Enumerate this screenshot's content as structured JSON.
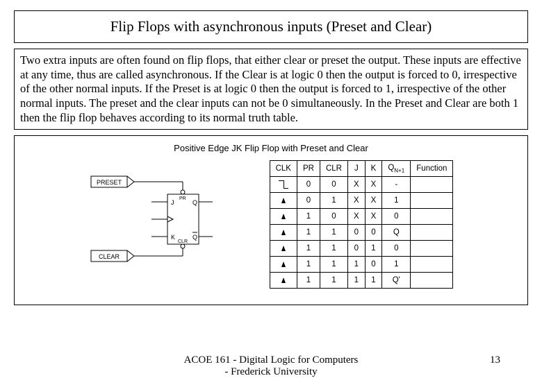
{
  "title": "Flip Flops with asynchronous inputs (Preset and Clear)",
  "body_text": "Two extra inputs are often found on flip flops, that either clear or preset the output. These inputs are effective at any time, thus are called asynchronous. If the Clear is at logic 0 then the output is forced to 0, irrespective of the other normal inputs. If the Preset is at logic 0 then the output is forced to 1, irrespective of the other normal inputs. The preset and the clear inputs can not be 0 simultaneously. In the Preset and Clear are both 1 then the flip flop behaves according to its normal truth table.",
  "figure_title": "Positive Edge JK Flip Flop with Preset and Clear",
  "circuit": {
    "preset_label": "PRESET",
    "clear_label": "CLEAR",
    "j_label": "J",
    "k_label": "K",
    "pr_label": "PR",
    "clr_label": "CLR",
    "q_label": "Q",
    "qbar_label": "Q"
  },
  "table": {
    "headers": [
      "CLK",
      "PR",
      "CLR",
      "J",
      "K",
      "QN+1",
      "Function"
    ],
    "rows": [
      {
        "clk": "fall",
        "pr": "0",
        "clr": "0",
        "j": "X",
        "k": "X",
        "q": "-",
        "func": ""
      },
      {
        "clk": "rise",
        "pr": "0",
        "clr": "1",
        "j": "X",
        "k": "X",
        "q": "1",
        "func": ""
      },
      {
        "clk": "rise",
        "pr": "1",
        "clr": "0",
        "j": "X",
        "k": "X",
        "q": "0",
        "func": ""
      },
      {
        "clk": "rise",
        "pr": "1",
        "clr": "1",
        "j": "0",
        "k": "0",
        "q": "Q",
        "func": ""
      },
      {
        "clk": "rise",
        "pr": "1",
        "clr": "1",
        "j": "0",
        "k": "1",
        "q": "0",
        "func": ""
      },
      {
        "clk": "rise",
        "pr": "1",
        "clr": "1",
        "j": "1",
        "k": "0",
        "q": "1",
        "func": ""
      },
      {
        "clk": "rise",
        "pr": "1",
        "clr": "1",
        "j": "1",
        "k": "1",
        "q": "Q'",
        "func": ""
      }
    ]
  },
  "footer_center_line1": "ACOE 161 - Digital Logic for Computers",
  "footer_center_line2": "- Frederick University",
  "page_number": "13"
}
